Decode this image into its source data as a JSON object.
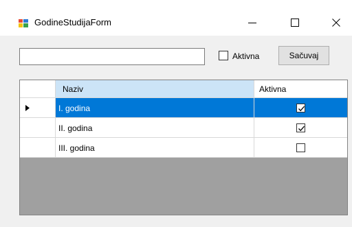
{
  "window": {
    "title": "GodineStudijaForm",
    "icon": "winforms-app-icon"
  },
  "form": {
    "naziv_input_value": "",
    "aktivna_label": "Aktivna",
    "aktivna_checked": false,
    "save_label": "Sačuvaj"
  },
  "grid": {
    "columns": [
      "Naziv",
      "Aktivna"
    ],
    "rows": [
      {
        "naziv": "I. godina",
        "aktivna": true,
        "selected": true,
        "current": true
      },
      {
        "naziv": "II. godina",
        "aktivna": true,
        "selected": false,
        "current": false
      },
      {
        "naziv": "III. godina",
        "aktivna": false,
        "selected": false,
        "current": false
      }
    ]
  },
  "colors": {
    "selection": "#0078d7",
    "header_highlight": "#cce4f7",
    "grid_background": "#a0a0a0",
    "form_background": "#f0f0f0"
  }
}
